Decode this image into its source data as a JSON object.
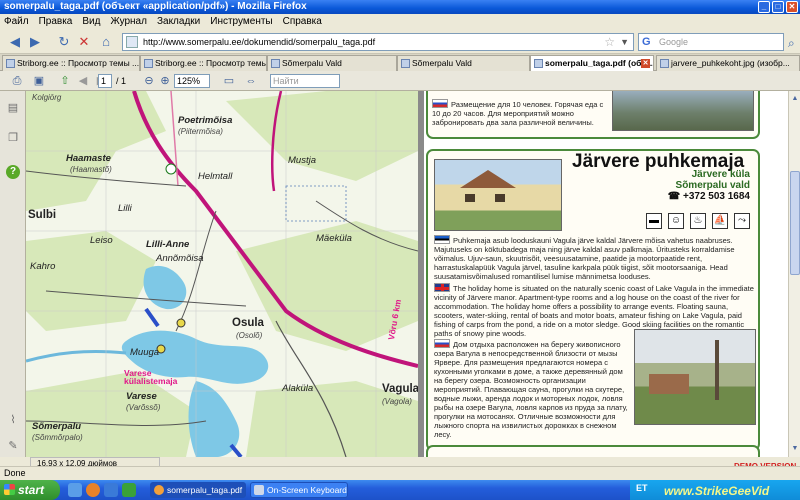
{
  "window": {
    "title": "somerpalu_taga.pdf (объект «application/pdf») - Mozilla Firefox"
  },
  "menu": [
    "Файл",
    "Правка",
    "Вид",
    "Журнал",
    "Закладки",
    "Инструменты",
    "Справка"
  ],
  "nav": {
    "url": "http://www.somerpalu.ee/dokumendid/somerpalu_taga.pdf",
    "search_placeholder": "Google"
  },
  "tabs": [
    {
      "label": "Striborg.ee :: Просмотр темы ...",
      "active": false
    },
    {
      "label": "Striborg.ee :: Просмотр темы ...",
      "active": false
    },
    {
      "label": "Sõmerpalu Vald",
      "active": false
    },
    {
      "label": "Sõmerpalu Vald",
      "active": false
    },
    {
      "label": "somerpalu_taga.pdf (объ...",
      "active": true
    },
    {
      "label": "jarvere_puhkekoht.jpg (изобр...",
      "active": false
    }
  ],
  "pdf_toolbar": {
    "page": "1",
    "page_total": "/ 1",
    "zoom": "125%",
    "find_placeholder": "Найти"
  },
  "map": {
    "places": [
      {
        "text": "Kolgiōrg",
        "style": "sub"
      },
      {
        "text": "Poetrimõisa",
        "style": "bold"
      },
      {
        "text": "(Piitermõisa)",
        "style": "sub"
      },
      {
        "text": "Haamaste",
        "style": "bold"
      },
      {
        "text": "(Haamastõ)",
        "style": "sub"
      },
      {
        "text": "Helmtall",
        "style": ""
      },
      {
        "text": "Mustja",
        "style": ""
      },
      {
        "text": "Sulbi",
        "style": "big"
      },
      {
        "text": "Lilli",
        "style": ""
      },
      {
        "text": "Leiso",
        "style": ""
      },
      {
        "text": "Lilli-Anne",
        "style": "bold"
      },
      {
        "text": "Annõmõisa",
        "style": ""
      },
      {
        "text": "Mäeküla",
        "style": ""
      },
      {
        "text": "Kahro",
        "style": ""
      },
      {
        "text": "Osula",
        "style": "big"
      },
      {
        "text": "(Osolõ)",
        "style": "sub"
      },
      {
        "text": "Muuga",
        "style": ""
      },
      {
        "text": "Varese külalistemaja",
        "style": "pink"
      },
      {
        "text": "Varese",
        "style": "bold"
      },
      {
        "text": "(Varõssõ)",
        "style": "sub"
      },
      {
        "text": "Alaküla",
        "style": ""
      },
      {
        "text": "Vagula",
        "style": "big"
      },
      {
        "text": "(Vagola)",
        "style": "sub"
      },
      {
        "text": "Sõmerpalu",
        "style": "bold"
      },
      {
        "text": "(Sõmmõrpalo)",
        "style": "sub"
      },
      {
        "text": "Võru 6 km",
        "style": "pink"
      }
    ]
  },
  "info": {
    "top_card_text": "Размещение для 10 человек. Горячая еда с 10 до 20 часов. Для мероприятий можно забронировать два зала различной величины.",
    "title": "Järvere puhkemaja",
    "location1": "Järvere küla",
    "location2": "Sõmerpalu vald",
    "phone": "☎ +372 503 1684",
    "amenities": [
      "bed-icon",
      "smiley-icon",
      "sauna-icon",
      "boat-icon",
      "fishing-icon"
    ],
    "text_et": "Puhkemaja asub looduskauni Vagula järve kaldal Järvere mõisa vahetus naabruses. Majutuseks on köktubadega maja ning järve kaldal asuv palkmaja. Üritusteks korraldamise võimalus. Ujuv-saun, skuutrisõit, veesuusatamine, paatide ja mootorpaatide rent, harrastuskalapüük Vagula järvel, tasuline karkpala püük tiigist, sõit mootorsaaniga. Head suusatamisvõimalused romantilisel lumise männimetsa looduses.",
    "text_en": "The holiday home is situated on the naturally scenic coast of Lake Vagula in the immediate vicinity of Järvere manor. Apartment-type rooms and a log house on the coast of the river for accommodation. The holiday home offers a possibility to arrange events. Floating sauna, scooters, water-skiing, rental of boats and motor boats, amateur fishing on Lake Vagula, paid fishing of carps from the pond, a ride on a motor sledge. Good skiing facilities on the romantic paths of snowy pine woods.",
    "text_ru": "Дом отдыха расположен на берегу живописного озера Вагула в непосредственной близости от мызы Ярвере. Для размещения предлагаются номера с кухонными уголками в доме, а также деревянный дом на берегу озера. Возможность организации мероприятий. Плавающая сауна, прогулки на скутере, водные лыжи, аренда лодок и моторных лодок, ловля рыбы на озере Вагула, ловля карпов из пруда за плату, прогулки на мотосанях. Отличные возможности для лыжного спорта на извилистых дорожках в снежном лесу."
  },
  "status": {
    "text": "Done",
    "page_size": "16,93 x 12,09 дюймов"
  },
  "taskbar": {
    "start": "start",
    "buttons": [
      {
        "label": "somerpalu_taga.pdf (...",
        "active": true
      },
      {
        "label": "On-Screen Keyboard",
        "active": false
      }
    ],
    "tray_lang": "ET"
  },
  "watermark": {
    "demo": "DEMO VERSION",
    "brand": "www.StrikeGeeVid"
  },
  "colors": {
    "road": "#c0147a",
    "water": "#7ec8e6",
    "forest": "#d7e8b9",
    "card_border": "#4b8a3b",
    "accent_green": "#2b6a22"
  }
}
